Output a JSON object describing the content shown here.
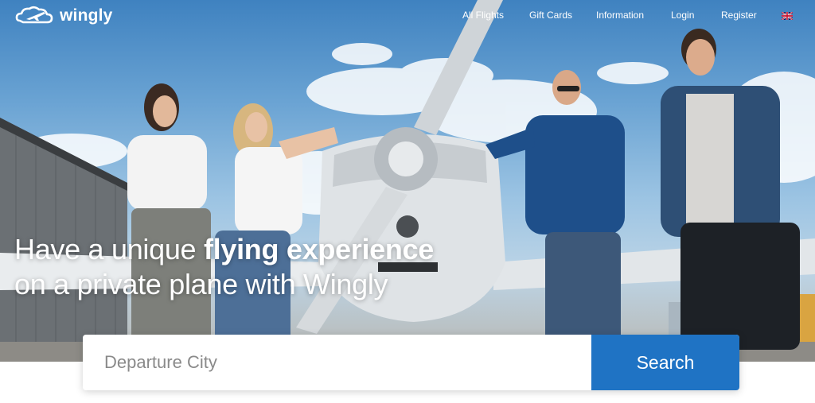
{
  "brand": {
    "name": "wingly"
  },
  "nav": {
    "items": [
      {
        "label": "All Flights"
      },
      {
        "label": "Gift Cards"
      },
      {
        "label": "Information"
      },
      {
        "label": "Login"
      },
      {
        "label": "Register"
      }
    ],
    "language_flag": "uk-flag-icon"
  },
  "hero": {
    "headline_part1": "Have a unique ",
    "headline_bold": "flying experience",
    "headline_line2": "on a private plane with Wingly"
  },
  "search": {
    "placeholder": "Departure City",
    "button_label": "Search"
  },
  "colors": {
    "accent": "#1f73c4",
    "text_on_hero": "#ffffff"
  }
}
